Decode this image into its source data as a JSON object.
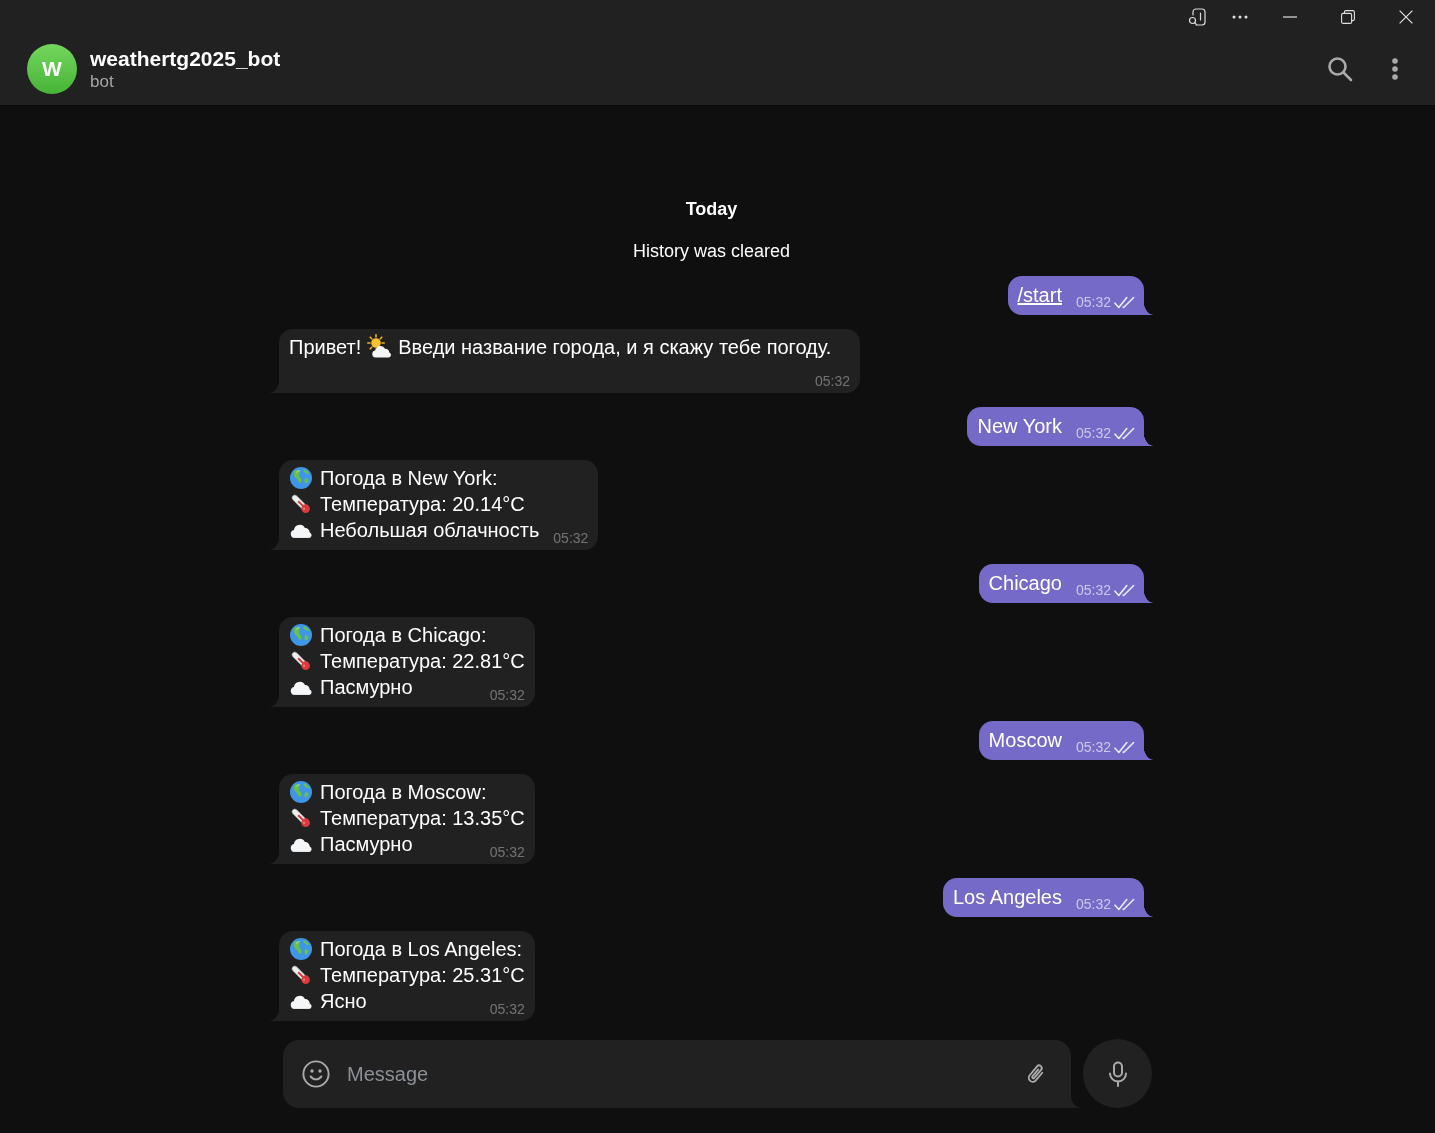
{
  "chat": {
    "avatar_letter": "W",
    "title": "weathertg2025_bot",
    "subtitle": "bot"
  },
  "messages": [
    {
      "kind": "date",
      "text": "Today"
    },
    {
      "kind": "service",
      "text": "History was cleared"
    },
    {
      "kind": "outgoing",
      "text": "/start",
      "link": true,
      "time": "05:32",
      "read": true
    },
    {
      "kind": "incoming",
      "time": "05:32",
      "lines": [
        {
          "kind": "greeting",
          "text": "Привет!",
          "text_after": "Введи название города, и я скажу тебе погоду."
        }
      ]
    },
    {
      "kind": "outgoing",
      "text": "New York",
      "link": false,
      "time": "05:32",
      "read": true
    },
    {
      "kind": "incoming",
      "time": "05:32",
      "lines": [
        {
          "kind": "location",
          "text": "Погода в New York:"
        },
        {
          "kind": "temperature",
          "text": "Температура: 20.14°C"
        },
        {
          "kind": "condition",
          "text": "Небольшая облачность"
        }
      ]
    },
    {
      "kind": "outgoing",
      "text": "Chicago",
      "link": false,
      "time": "05:32",
      "read": true
    },
    {
      "kind": "incoming",
      "time": "05:32",
      "lines": [
        {
          "kind": "location",
          "text": "Погода в Chicago:"
        },
        {
          "kind": "temperature",
          "text": "Температура: 22.81°C"
        },
        {
          "kind": "condition",
          "text": "Пасмурно"
        }
      ]
    },
    {
      "kind": "outgoing",
      "text": "Moscow",
      "link": false,
      "time": "05:32",
      "read": true
    },
    {
      "kind": "incoming",
      "time": "05:32",
      "lines": [
        {
          "kind": "location",
          "text": "Погода в Moscow:"
        },
        {
          "kind": "temperature",
          "text": "Температура: 13.35°C"
        },
        {
          "kind": "condition",
          "text": "Пасмурно"
        }
      ]
    },
    {
      "kind": "outgoing",
      "text": "Los Angeles",
      "link": false,
      "time": "05:32",
      "read": true
    },
    {
      "kind": "incoming",
      "time": "05:32",
      "lines": [
        {
          "kind": "location",
          "text": "Погода в Los Angeles:"
        },
        {
          "kind": "temperature",
          "text": "Температура: 25.31°C"
        },
        {
          "kind": "condition",
          "text": "Ясно"
        }
      ]
    }
  ],
  "composer": {
    "placeholder": "Message"
  }
}
